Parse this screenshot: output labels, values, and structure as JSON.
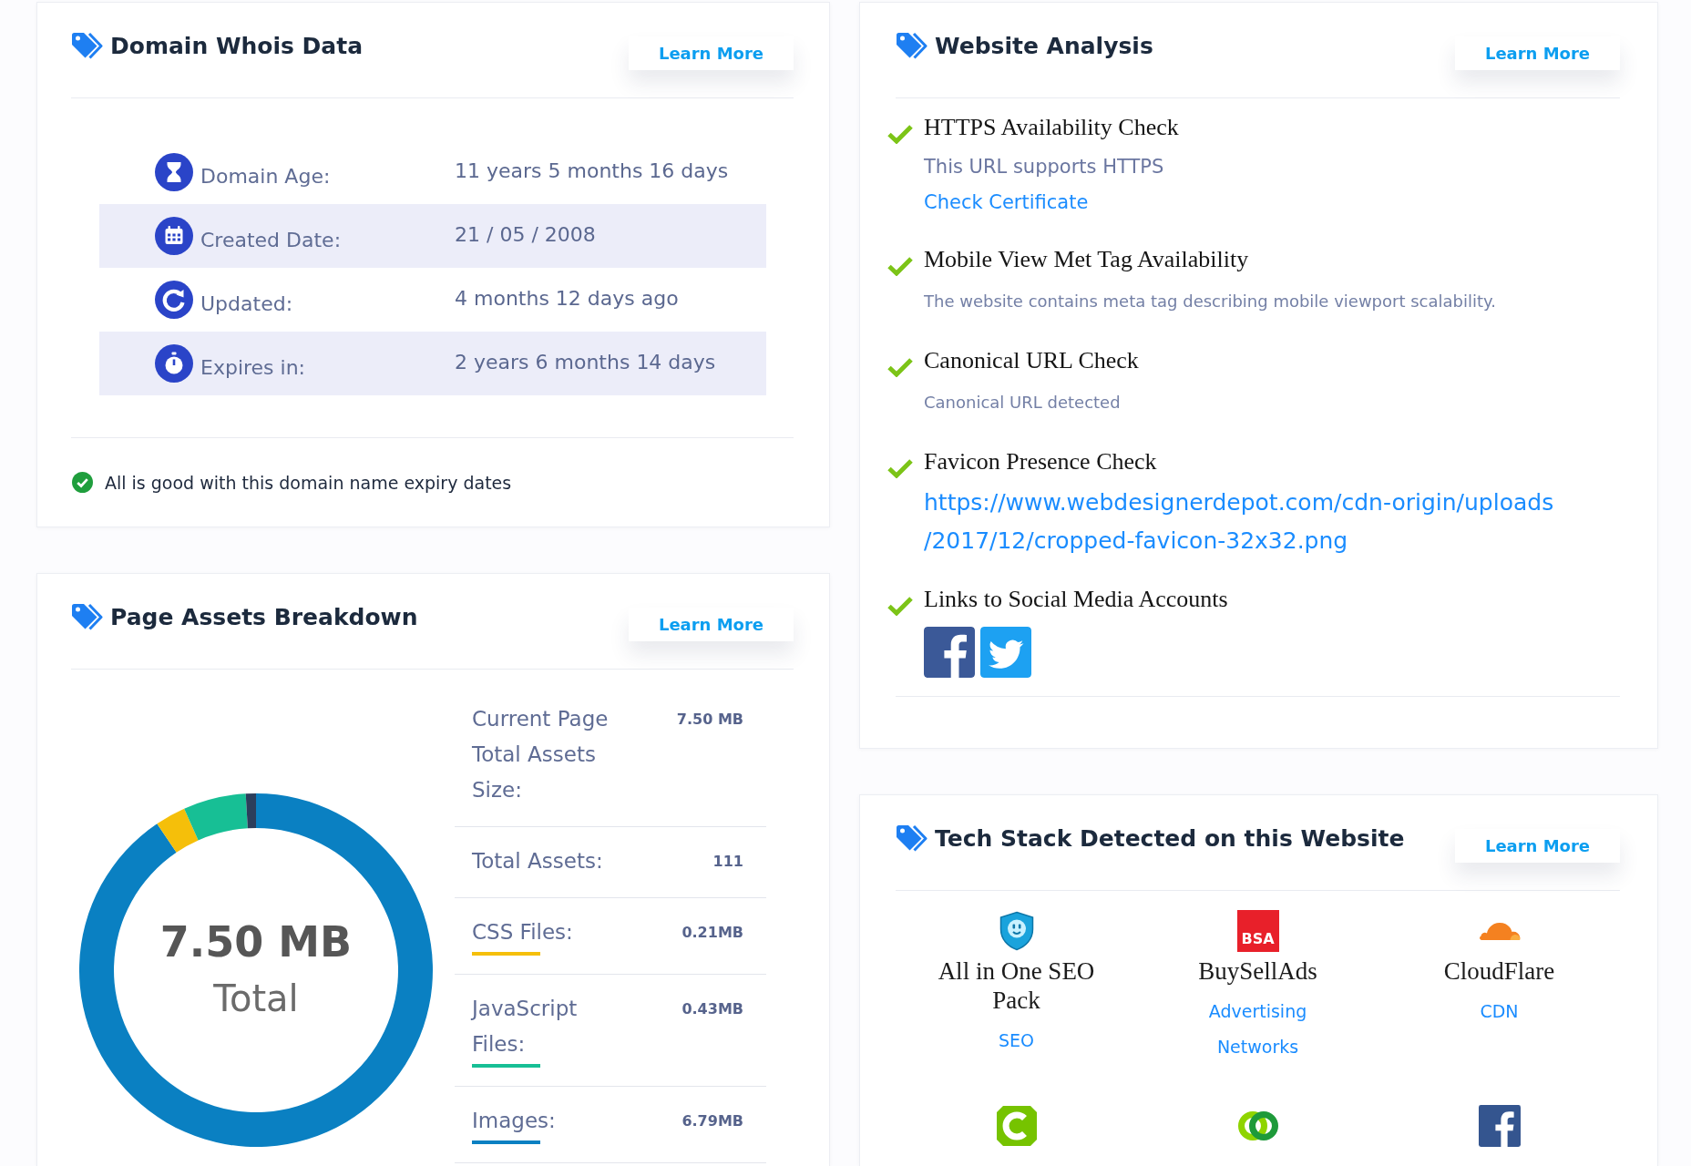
{
  "whois": {
    "title": "Domain Whois Data",
    "button": "Learn More",
    "rows": [
      {
        "kind": "age",
        "label": "Domain Age:",
        "value": "11 years 5 months 16 days"
      },
      {
        "kind": "created",
        "label": "Created Date:",
        "value": "21 / 05 / 2008"
      },
      {
        "kind": "updated",
        "label": "Updated:",
        "value": "4 months 12 days ago"
      },
      {
        "kind": "expires",
        "label": "Expires in:",
        "value": "2 years 6 months 14 days"
      }
    ],
    "status": {
      "ok": true,
      "text": "All is good with this domain name expiry dates"
    }
  },
  "assets": {
    "title": "Page Assets Breakdown",
    "button": "Learn More",
    "chart_data": {
      "type": "donut",
      "values": [
        90.54,
        2.8,
        5.73,
        0.93
      ],
      "colors": [
        "#0a80c2",
        "#f5bf0a",
        "#17bf95",
        "#2c3e5c"
      ]
    },
    "donut_center": {
      "value": "7.50 MB",
      "label": "Total"
    },
    "rows": [
      {
        "label": "Current Page Total Assets Size:",
        "value": "7.50 MB"
      },
      {
        "label": "Total Assets:",
        "value": "111"
      },
      {
        "label": "CSS Files:",
        "value": "0.21MB",
        "color": "#f5bf0a"
      },
      {
        "label": "JavaScript Files:",
        "value": "0.43MB",
        "color": "#17bf95"
      },
      {
        "label": "Images:",
        "value": "6.79MB",
        "color": "#0a80c2"
      }
    ]
  },
  "analysis": {
    "title": "Website Analysis",
    "button": "Learn More",
    "checks": [
      {
        "passed": true,
        "title": "HTTPS Availability Check",
        "text": "This URL supports HTTPS",
        "link": "Check Certificate"
      },
      {
        "passed": true,
        "title": "Mobile View Met Tag Availability",
        "note": "The website contains meta tag describing mobile viewport scalability."
      },
      {
        "passed": true,
        "title": "Canonical URL Check",
        "note": "Canonical URL detected"
      },
      {
        "passed": true,
        "title": "Favicon Presence Check",
        "url": "https://www.webdesignerdepot.com/cdn-origin/uploads/2017/12/cropped-favicon-32x32.png"
      },
      {
        "passed": true,
        "title": "Links to Social Media Accounts",
        "socials": [
          {
            "kind": "facebook"
          },
          {
            "kind": "twitter"
          }
        ]
      }
    ]
  },
  "tech": {
    "title": "Tech Stack Detected on this Website",
    "button": "Learn More",
    "items": [
      {
        "kind": "shield",
        "name": "All in One SEO Pack",
        "category": "SEO"
      },
      {
        "kind": "tile",
        "logo_text": "BSA",
        "name": "BuySellAds",
        "category": "Advertising Networks"
      },
      {
        "kind": "cloud",
        "name": "CloudFlare",
        "category": "CDN"
      },
      {
        "kind": "ctile"
      },
      {
        "kind": "rings"
      },
      {
        "kind": "facebook"
      }
    ]
  }
}
